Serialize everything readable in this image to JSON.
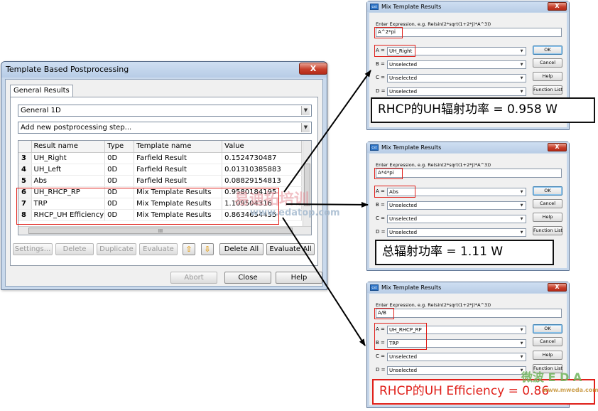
{
  "main_window": {
    "title": "Template Based Postprocessing",
    "close_label": "X",
    "tab_label": "General Results",
    "category_select": "General 1D",
    "step_select": "Add new postprocessing step...",
    "table": {
      "headers": [
        "",
        "Result name",
        "Type",
        "Template name",
        "Value"
      ],
      "rows": [
        {
          "num": "3",
          "name": "UH_Right",
          "type": "0D",
          "template": "Farfield Result",
          "value": "0.1524730487"
        },
        {
          "num": "4",
          "name": "UH_Left",
          "type": "0D",
          "template": "Farfield Result",
          "value": "0.01310385883"
        },
        {
          "num": "5",
          "name": "Abs",
          "type": "0D",
          "template": "Farfield Result",
          "value": "0.08829154813"
        },
        {
          "num": "6",
          "name": "UH_RHCP_RP",
          "type": "0D",
          "template": "Mix Template Results",
          "value": "0.9580184195"
        },
        {
          "num": "7",
          "name": "TRP",
          "type": "0D",
          "template": "Mix Template Results",
          "value": "1.109504316"
        },
        {
          "num": "8",
          "name": "RHCP_UH Efficiency",
          "type": "0D",
          "template": "Mix Template Results",
          "value": "0.8634654455"
        }
      ],
      "hscroll_grip": "III"
    },
    "buttons": {
      "settings": "Settings...",
      "delete": "Delete",
      "duplicate": "Duplicate",
      "evaluate": "Evaluate",
      "up": "⇧",
      "down": "⇩",
      "delete_all": "Delete All",
      "evaluate_all": "Evaluate All"
    },
    "footer": {
      "abort": "Abort",
      "close": "Close",
      "help": "Help"
    }
  },
  "watermark": {
    "text1": "易迪拓培训",
    "text2": "www.edatop.com",
    "text3": "微波 E D A",
    "text4": "www.mweda.com"
  },
  "mix_common": {
    "title": "Mix Template Results",
    "app_icon": "cst",
    "close_label": "X",
    "hint": "Enter Expression, e.g. Re(sin(2*sqrt(1+2*j)*A^3))",
    "labels": {
      "a": "A =",
      "b": "B =",
      "c": "C =",
      "d": "D ="
    },
    "btn_ok": "OK",
    "btn_cancel": "Cancel",
    "btn_help": "Help",
    "btn_function_list": "Function List"
  },
  "mix1": {
    "expression": "A^2*pi",
    "a": "UH_Right",
    "b": "Unselected",
    "c": "Unselected",
    "d": "Unselected",
    "annotation": "RHCP的UH辐射功率 = 0.958 W"
  },
  "mix2": {
    "expression": "A*4*pi",
    "a": "Abs",
    "b": "Unselected",
    "c": "Unselected",
    "d": "Unselected",
    "annotation": "总辐射功率 = 1.11 W"
  },
  "mix3": {
    "expression": "A/B",
    "a": "UH_RHCP_RP",
    "b": "TRP",
    "c": "Unselected",
    "d": "Unselected",
    "annotation": "RHCP的UH Efficiency = 0.86"
  },
  "colors": {
    "highlight_red": "#e0201a",
    "window_frame": "#c9d9ec",
    "arrow": "#000000"
  }
}
